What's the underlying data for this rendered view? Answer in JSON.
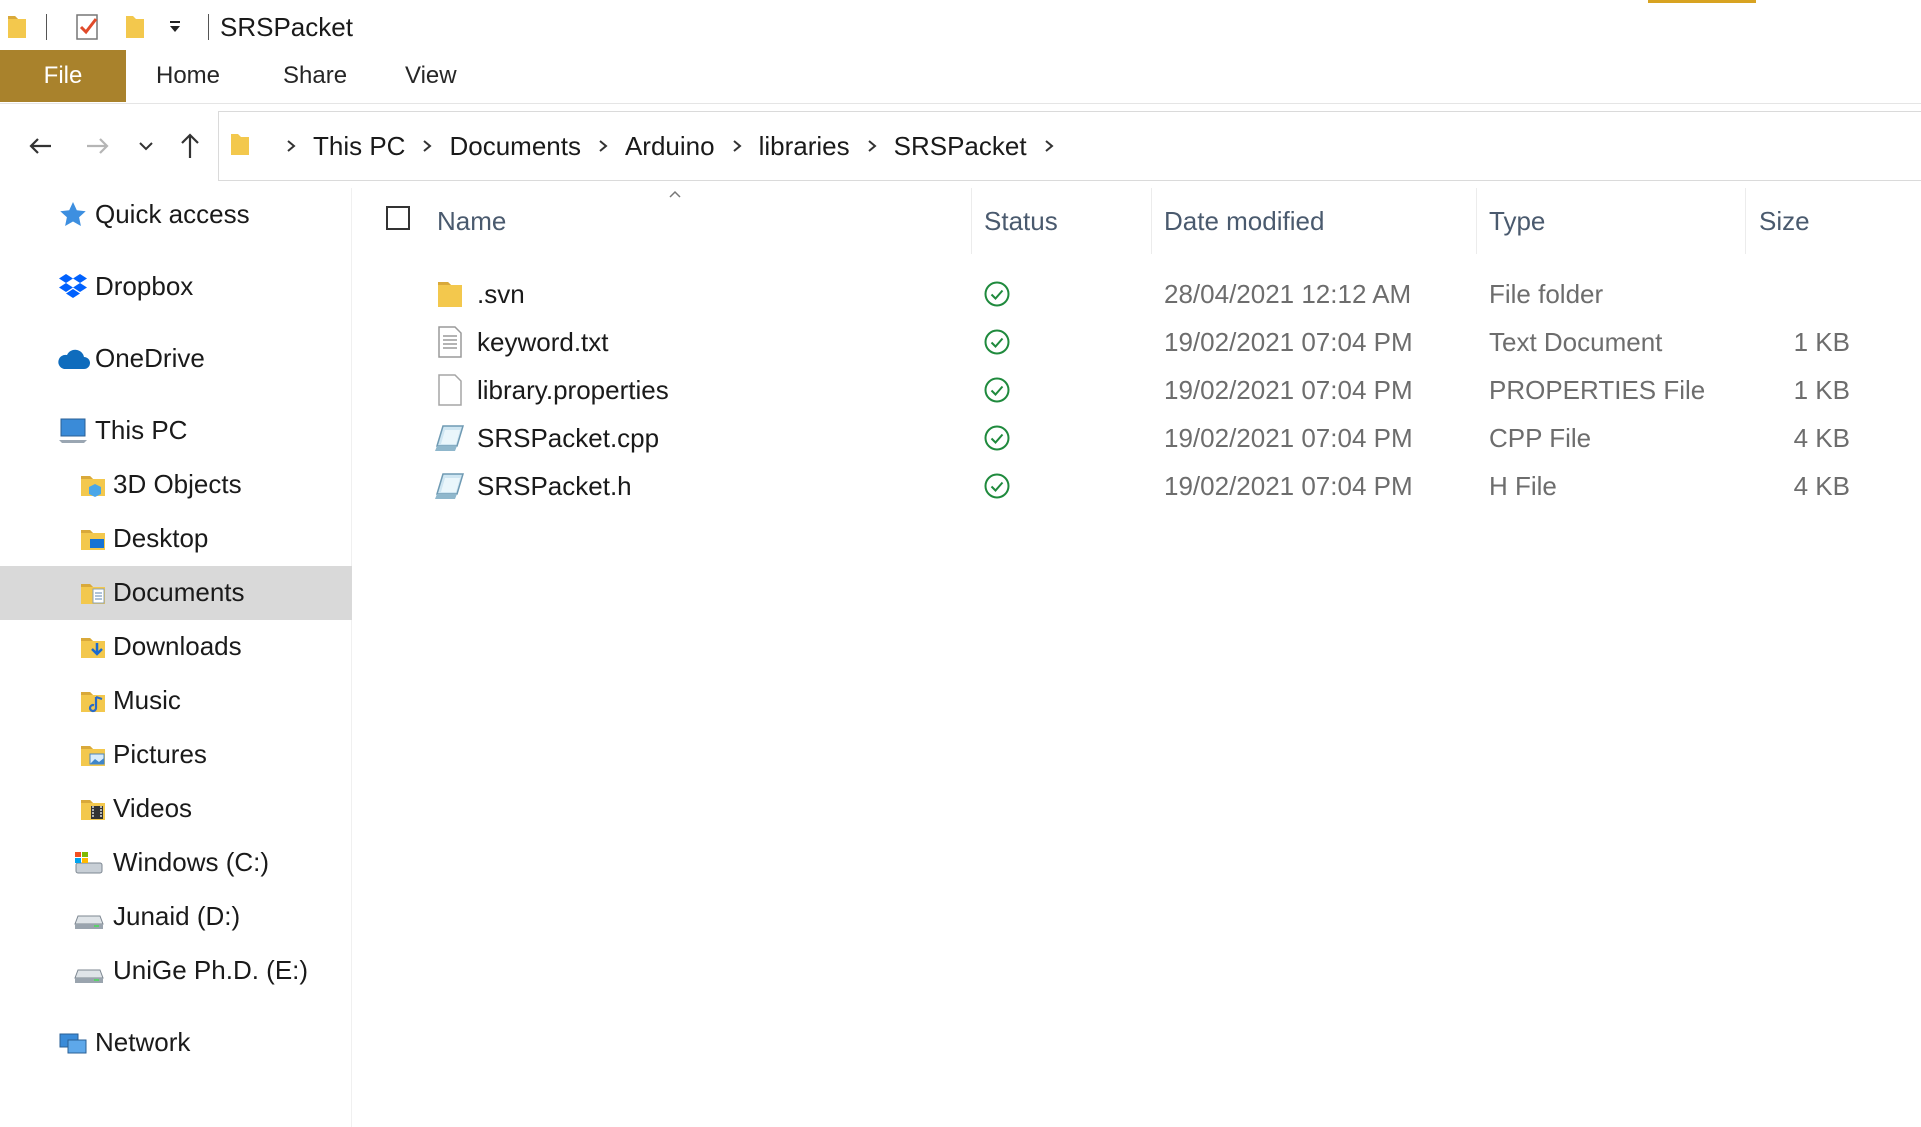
{
  "window": {
    "title": "SRSPacket"
  },
  "ribbon": {
    "tabs": [
      {
        "label": "File"
      },
      {
        "label": "Home"
      },
      {
        "label": "Share"
      },
      {
        "label": "View"
      }
    ]
  },
  "address": {
    "crumbs": [
      "This PC",
      "Documents",
      "Arduino",
      "libraries",
      "SRSPacket"
    ]
  },
  "sidebar": {
    "items": [
      {
        "label": "Quick access",
        "icon": "star-icon"
      },
      {
        "label": "Dropbox",
        "icon": "dropbox-icon"
      },
      {
        "label": "OneDrive",
        "icon": "cloud-icon"
      },
      {
        "label": "This PC",
        "icon": "computer-icon"
      },
      {
        "label": "3D Objects",
        "icon": "3d-objects-folder-icon"
      },
      {
        "label": "Desktop",
        "icon": "desktop-folder-icon"
      },
      {
        "label": "Documents",
        "icon": "documents-folder-icon",
        "selected": true
      },
      {
        "label": "Downloads",
        "icon": "downloads-folder-icon"
      },
      {
        "label": "Music",
        "icon": "music-folder-icon"
      },
      {
        "label": "Pictures",
        "icon": "pictures-folder-icon"
      },
      {
        "label": "Videos",
        "icon": "videos-folder-icon"
      },
      {
        "label": "Windows (C:)",
        "icon": "windows-drive-icon"
      },
      {
        "label": "Junaid (D:)",
        "icon": "drive-icon"
      },
      {
        "label": "UniGe Ph.D. (E:)",
        "icon": "drive-icon"
      },
      {
        "label": "Network",
        "icon": "network-icon"
      }
    ]
  },
  "columns": {
    "name": "Name",
    "status": "Status",
    "date": "Date modified",
    "type": "Type",
    "size": "Size"
  },
  "files": [
    {
      "name": ".svn",
      "date": "28/04/2021 12:12 AM",
      "type": "File folder",
      "size": "",
      "icon": "folder-icon",
      "status": "synced-check-icon"
    },
    {
      "name": "keyword.txt",
      "date": "19/02/2021 07:04 PM",
      "type": "Text Document",
      "size": "1 KB",
      "icon": "text-file-icon",
      "status": "synced-check-icon"
    },
    {
      "name": "library.properties",
      "date": "19/02/2021 07:04 PM",
      "type": "PROPERTIES File",
      "size": "1 KB",
      "icon": "blank-file-icon",
      "status": "synced-check-icon"
    },
    {
      "name": "SRSPacket.cpp",
      "date": "19/02/2021 07:04 PM",
      "type": "CPP File",
      "size": "4 KB",
      "icon": "code-file-icon",
      "status": "synced-check-icon"
    },
    {
      "name": "SRSPacket.h",
      "date": "19/02/2021 07:04 PM",
      "type": "H File",
      "size": "4 KB",
      "icon": "code-file-icon",
      "status": "synced-check-icon"
    }
  ],
  "colors": {
    "file_tab": "#a9822c",
    "folder": "#f3c84d",
    "status_ok": "#1f8a3d",
    "selected": "#d9d9d9"
  }
}
